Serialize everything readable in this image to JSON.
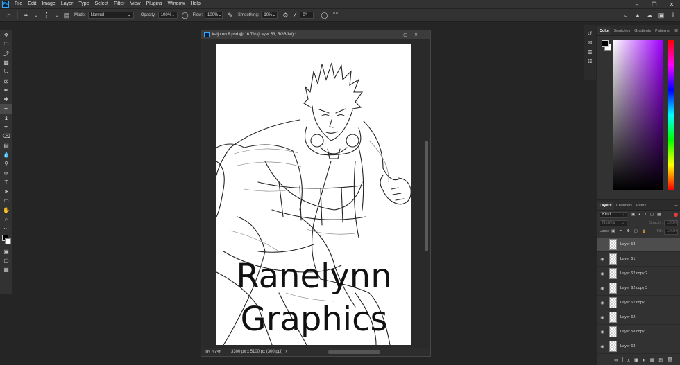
{
  "app": {
    "logo": "Ps"
  },
  "menu": [
    "File",
    "Edit",
    "Image",
    "Layer",
    "Type",
    "Select",
    "Filter",
    "View",
    "Plugins",
    "Window",
    "Help"
  ],
  "options": {
    "mode_label": "Mode:",
    "mode_value": "Normal",
    "opacity_label": "Opacity:",
    "opacity_value": "100%",
    "flow_label": "Flow:",
    "flow_value": "100%",
    "smoothing_label": "Smoothing:",
    "smoothing_value": "10%",
    "angle_value": "0°",
    "brush_size": "6"
  },
  "document": {
    "title": "kaiju no 8.psd @ 16.7% (Layer 53, RGB/8#) *",
    "zoom": "16.67%",
    "size_info": "3300 px x 5100 px (300 ppi)",
    "watermark_line1": "Ranelynn",
    "watermark_line2": "Graphics"
  },
  "color_panel": {
    "tabs": [
      "Color",
      "Swatches",
      "Gradients",
      "Patterns"
    ]
  },
  "layers_panel": {
    "tabs": [
      "Layers",
      "Channels",
      "Paths"
    ],
    "kind_label": "Kind",
    "blend_mode": "Normal",
    "opacity_label": "Opacity:",
    "opacity_value": "100%",
    "lock_label": "Lock:",
    "fill_label": "Fill:",
    "fill_value": "100%",
    "layers": [
      {
        "name": "Layer 53",
        "selected": true
      },
      {
        "name": "Layer 61",
        "selected": false
      },
      {
        "name": "Layer 62 copy 2",
        "selected": false
      },
      {
        "name": "Layer 62 copy 3",
        "selected": false
      },
      {
        "name": "Layer 62 copy",
        "selected": false
      },
      {
        "name": "Layer 62",
        "selected": false
      },
      {
        "name": "Layer 58 copy",
        "selected": false
      },
      {
        "name": "Layer 63",
        "selected": false
      }
    ]
  },
  "colors": {
    "bg": "#252525",
    "panel": "#323232",
    "accent": "#31a8ff"
  }
}
